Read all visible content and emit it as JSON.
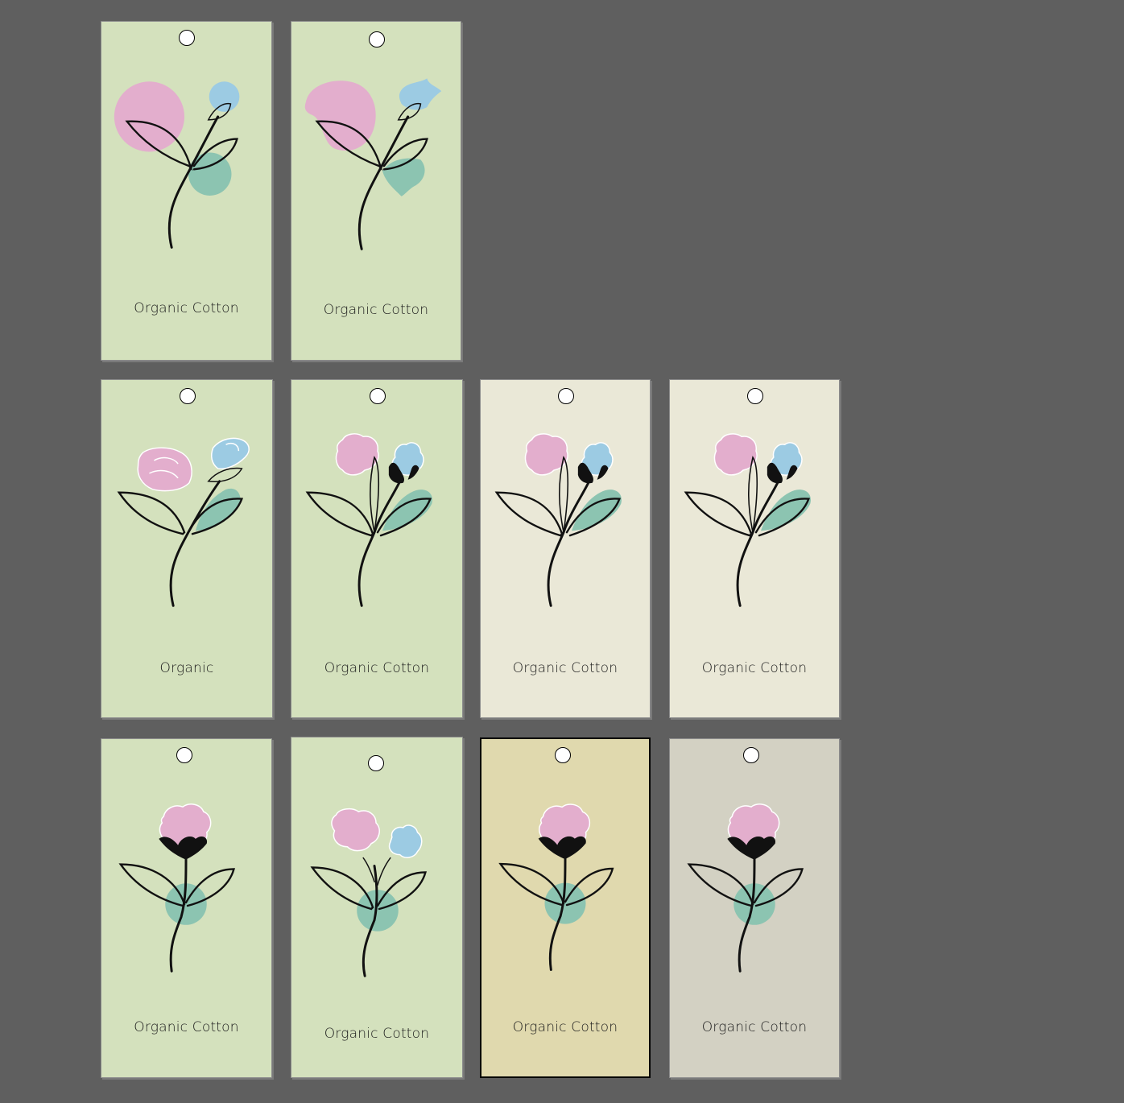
{
  "colors": {
    "canvas": "#5f5f5f",
    "green_bg": "#d4e1bd",
    "cream_bg": "#eae8d7",
    "ochre_bg": "#e0d9ae",
    "grey_bg": "#d3d1c3",
    "accent_pink": "#e3aecd",
    "accent_blue": "#9ccbe3",
    "accent_teal": "#8cc4b1"
  },
  "tags": [
    {
      "label": "Organic Cotton",
      "bg": "green",
      "style": "circles"
    },
    {
      "label": "Organic Cotton",
      "bg": "green",
      "style": "blobs"
    },
    {
      "label": "Organic",
      "bg": "green",
      "style": "roses"
    },
    {
      "label": "Organic Cotton",
      "bg": "green",
      "style": "bolls"
    },
    {
      "label": "Organic Cotton",
      "bg": "cream",
      "style": "bolls"
    },
    {
      "label": "Organic Cotton",
      "bg": "cream",
      "style": "bolls"
    },
    {
      "label": "Organic Cotton",
      "bg": "green",
      "style": "single"
    },
    {
      "label": "Organic Cotton",
      "bg": "green",
      "style": "double"
    },
    {
      "label": "Organic Cotton",
      "bg": "ochre",
      "style": "single",
      "selected": true
    },
    {
      "label": "Organic Cotton",
      "bg": "grey",
      "style": "single"
    }
  ]
}
